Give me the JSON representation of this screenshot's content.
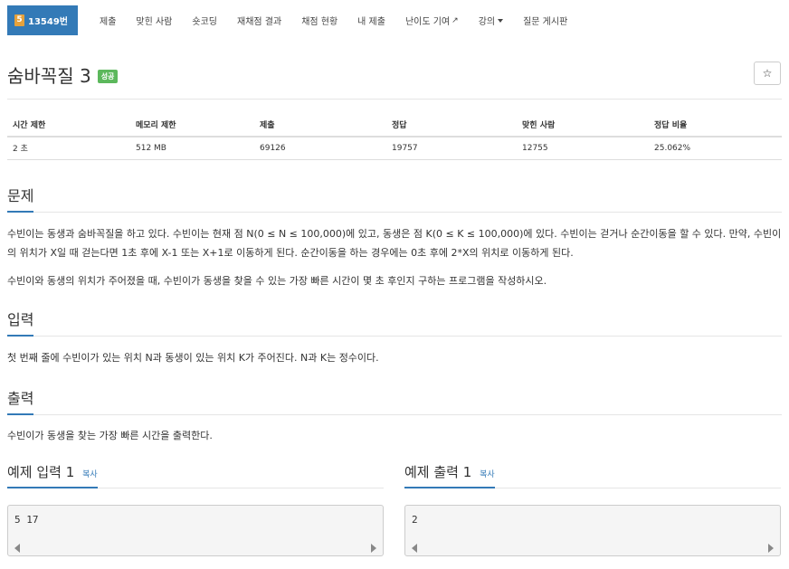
{
  "nav": {
    "active_badge": "5",
    "active_label": "13549번",
    "items": [
      "제출",
      "맞힌 사람",
      "숏코딩",
      "재채점 결과",
      "채점 현황",
      "내 제출",
      "난이도 기여",
      "강의",
      "질문 게시판"
    ]
  },
  "problem": {
    "title": "숨바꼭질 3",
    "status_badge": "성공",
    "star": "☆"
  },
  "info": {
    "headers": [
      "시간 제한",
      "메모리 제한",
      "제출",
      "정답",
      "맞힌 사람",
      "정답 비율"
    ],
    "values": [
      "2 초",
      "512 MB",
      "69126",
      "19757",
      "12755",
      "25.062%"
    ]
  },
  "sections": {
    "problem_h": "문제",
    "problem_p1": "수빈이는 동생과 숨바꼭질을 하고 있다. 수빈이는 현재 점 N(0 ≤ N ≤ 100,000)에 있고, 동생은 점 K(0 ≤ K ≤ 100,000)에 있다. 수빈이는 걷거나 순간이동을 할 수 있다. 만약, 수빈이의 위치가 X일 때 걷는다면 1초 후에 X-1 또는 X+1로 이동하게 된다. 순간이동을 하는 경우에는 0초 후에 2*X의 위치로 이동하게 된다.",
    "problem_p2": "수빈이와 동생의 위치가 주어졌을 때, 수빈이가 동생을 찾을 수 있는 가장 빠른 시간이 몇 초 후인지 구하는 프로그램을 작성하시오.",
    "input_h": "입력",
    "input_p": "첫 번째 줄에 수빈이가 있는 위치 N과 동생이 있는 위치 K가 주어진다. N과 K는 정수이다.",
    "output_h": "출력",
    "output_p": "수빈이가 동생을 찾는 가장 빠른 시간을 출력한다."
  },
  "examples": {
    "input_h": "예제 입력 1",
    "output_h": "예제 출력 1",
    "copy": "복사",
    "input_val": "5 17",
    "output_val": "2"
  }
}
